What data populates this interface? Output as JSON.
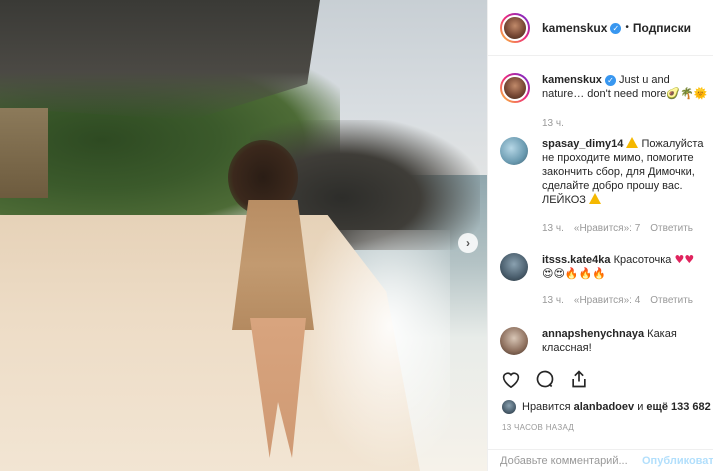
{
  "photo": {
    "next_arrow": "›"
  },
  "header": {
    "username": "kamenskux",
    "separator": "•",
    "follow_label": "Подписки"
  },
  "caption": {
    "username": "kamenskux",
    "text": "Just u and nature… don't need more",
    "emoji": "🥑🌴🌞",
    "time": "13 ч."
  },
  "comments": [
    {
      "username": "spasay_dimy14",
      "text": "Пожалуйста не проходите мимо, помогите закончить сбор, для Димочки, сделайте добро прошу вас. ЛЕЙКОЗ",
      "time": "13 ч.",
      "likes": "«Нравится»: 7",
      "reply": "Ответить"
    },
    {
      "username": "itsss.kate4ka",
      "text": "Красоточка",
      "emoji_line1": "♥♥",
      "emoji_line2": "😍😍🔥🔥🔥",
      "time": "13 ч.",
      "likes": "«Нравится»: 4",
      "reply": "Ответить"
    },
    {
      "username": "annapshenychnaya",
      "text": "Какая классная!"
    }
  ],
  "likes": {
    "prefix": "Нравится",
    "user": "alanbadoev",
    "and": "и",
    "count": "ещё 133 682"
  },
  "time_ago": "13 ЧАСОВ НАЗАД",
  "add_comment": {
    "placeholder": "Добавьте комментарий...",
    "publish_label": "Опубликовать"
  },
  "icons": [
    "heart-icon",
    "comment-icon",
    "share-icon",
    "verified-icon",
    "warning-icon"
  ]
}
